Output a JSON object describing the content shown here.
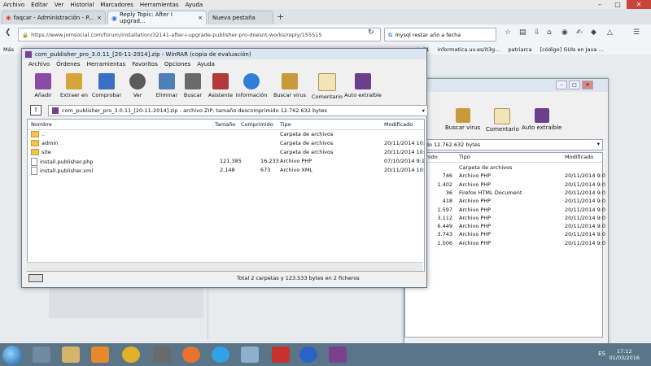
{
  "firefox": {
    "menu": [
      "Archivo",
      "Editar",
      "Ver",
      "Historial",
      "Marcadores",
      "Herramientas",
      "Ayuda"
    ],
    "tabs": [
      {
        "label": "faqcar - Administración - P...",
        "close": "×"
      },
      {
        "label": "Reply Topic: After I upgrad...",
        "close": "×"
      },
      {
        "label": "Nueva pestaña"
      }
    ],
    "new_tab": "+",
    "url": "https://www.jomsocial.com/forum/installation/32141-after-i-upgrade-publisher-pro-doesnt-works/reply/155515",
    "search": "mysql restar año a fecha",
    "bookmarks": [
      "Más",
      "gusta61",
      "informatica.uv.es/it3g...",
      "patriarca",
      "[código] GUIs en Java ..."
    ]
  },
  "winrar_main": {
    "title": "com_publisher_pro_3.0.11_[20-11-2014].zip - WinRAR (copia de evaluación)",
    "menu": [
      "Archivo",
      "Órdenes",
      "Herramientas",
      "Favoritos",
      "Opciones",
      "Ayuda"
    ],
    "tools": [
      "Añadir",
      "Extraer en",
      "Comprobar",
      "Ver",
      "Eliminar",
      "Buscar",
      "Asistente",
      "Información",
      "Buscar virus",
      "Comentario",
      "Auto extraíble"
    ],
    "path": "com_publisher_pro_3.0.11_[20-11-2014].zip - archivo ZIP, tamaño descomprimido 12.762.632 bytes",
    "columns": {
      "name": "Nombre",
      "size": "Tamaño",
      "packed": "Comprimido",
      "type": "Tipo",
      "modified": "Modificado"
    },
    "rows": [
      {
        "name": "..",
        "size": "",
        "packed": "",
        "type": "Carpeta de archivos",
        "modified": ""
      },
      {
        "name": "admin",
        "size": "",
        "packed": "",
        "type": "Carpeta de archivos",
        "modified": "20/11/2014 10:"
      },
      {
        "name": "site",
        "size": "",
        "packed": "",
        "type": "Carpeta de archivos",
        "modified": "20/11/2014 10:"
      },
      {
        "name": "install.publisher.php",
        "size": "121.385",
        "packed": "16.233",
        "type": "Archivo PHP",
        "modified": "07/10/2014 9:1"
      },
      {
        "name": "install.publisher.xml",
        "size": "2.148",
        "packed": "673",
        "type": "Archivo XML",
        "modified": "20/11/2014 10:"
      }
    ],
    "status": "Total 2 carpetas y 123.533 bytes en 2 ficheros"
  },
  "winrar_back": {
    "tools": [
      "acion",
      "Buscar virus",
      "Comentario",
      "Auto extraíble"
    ],
    "path": "nprimido 12.762.632 bytes",
    "columns": {
      "packed": "Comprimido",
      "type": "Tipo",
      "modified": "Modificado"
    },
    "rows": [
      {
        "packed": "",
        "type": "Carpeta de archivos",
        "modified": ""
      },
      {
        "packed": "746",
        "type": "Archivo PHP",
        "modified": "20/11/2014 9:0"
      },
      {
        "packed": "1.402",
        "type": "Archivo PHP",
        "modified": "20/11/2014 9:0"
      },
      {
        "packed": "36",
        "type": "Firefox HTML Document",
        "modified": "20/11/2014 9:0"
      },
      {
        "packed": "418",
        "type": "Archivo PHP",
        "modified": "20/11/2014 9:0"
      },
      {
        "packed": "1.597",
        "type": "Archivo PHP",
        "modified": "20/11/2014 9:0"
      },
      {
        "packed": "3.112",
        "type": "Archivo PHP",
        "modified": "20/11/2014 9:0"
      },
      {
        "packed": "6.449",
        "type": "Archivo PHP",
        "modified": "20/11/2014 9:0"
      },
      {
        "packed": "3.743",
        "type": "Archivo PHP",
        "modified": "20/11/2014 9:0"
      },
      {
        "packed": "1.006",
        "type": "Archivo PHP",
        "modified": "20/11/2014 9:0"
      }
    ]
  },
  "taskbar": {
    "lang": "ES",
    "time": "17:12",
    "date": "01/03/2016"
  }
}
